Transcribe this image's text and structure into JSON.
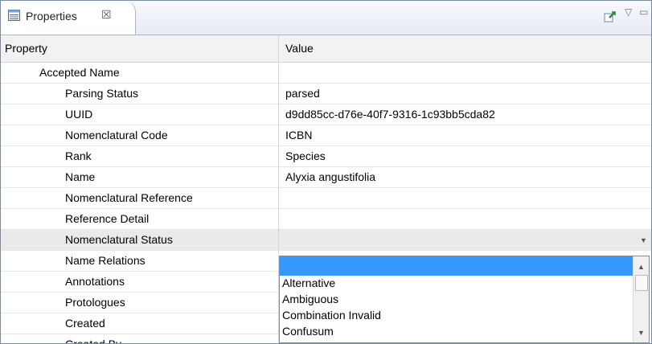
{
  "tab": {
    "title": "Properties",
    "close_glyph": "☒",
    "icon": "properties-table-icon"
  },
  "toolbar": {
    "pin_icon": "pin-icon",
    "menu_icon": "view-menu-icon",
    "minimize_icon": "minimize-icon",
    "menu_glyph": "▽",
    "minimize_glyph": "▭"
  },
  "columns": {
    "property": "Property",
    "value": "Value"
  },
  "rows": [
    {
      "property": "Accepted Name",
      "value": ""
    },
    {
      "property": "Parsing Status",
      "value": "parsed"
    },
    {
      "property": "UUID",
      "value": "d9dd85cc-d76e-40f7-9316-1c93bb5cda82"
    },
    {
      "property": "Nomenclatural Code",
      "value": "ICBN"
    },
    {
      "property": "Rank",
      "value": "Species"
    },
    {
      "property": "Name",
      "value": "Alyxia angustifolia"
    },
    {
      "property": "Nomenclatural Reference",
      "value": ""
    },
    {
      "property": "Reference Detail",
      "value": ""
    },
    {
      "property": "Nomenclatural Status",
      "value": ""
    },
    {
      "property": "Name Relations",
      "value": ""
    },
    {
      "property": "Annotations",
      "value": ""
    },
    {
      "property": "Protologues",
      "value": ""
    },
    {
      "property": "Created",
      "value": ""
    },
    {
      "property": "Created By",
      "value": ""
    }
  ],
  "dropdown": {
    "selected": "",
    "options": [
      "Alternative",
      "Ambiguous",
      "Combination Invalid",
      "Confusum"
    ]
  },
  "colors": {
    "selection": "#3399ff",
    "header_bg": "#f2f2f2",
    "selected_row_bg": "#eaeaea"
  }
}
